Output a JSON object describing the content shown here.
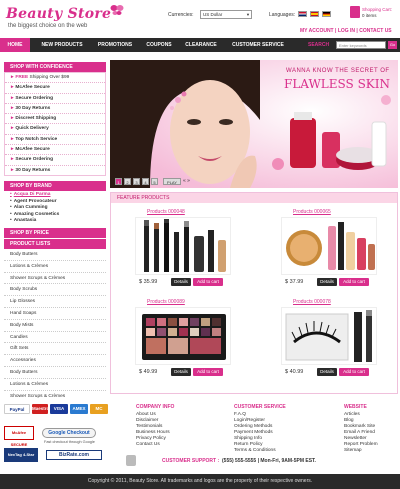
{
  "header": {
    "logo": "Beauty Store",
    "tagline": "the biggest choice on the web",
    "currencies_label": "Currencies:",
    "currency_value": "US Dollar",
    "languages_label": "Languages:",
    "cart_title": "Shopping Cart:",
    "cart_items": "0 items",
    "account_links": [
      "MY ACCOUNT",
      "LOG IN",
      "CONTACT US"
    ],
    "account_sep": " | "
  },
  "nav": {
    "items": [
      "HOME",
      "NEW PRODUCTS",
      "PROMOTIONS",
      "COUPONS",
      "CLEARANCE",
      "CUSTOMER SERVICE"
    ],
    "search_label": "SEARCH",
    "search_placeholder": "Enter keywords",
    "search_go": "Go"
  },
  "sidebar": {
    "shop_confidence_title": "SHOP WITH CONFIDENCE",
    "confidence_items": [
      {
        "prefix": "FREE",
        "label": " Shipping Over $99"
      },
      {
        "prefix": "",
        "label": "McAfee Secure"
      },
      {
        "prefix": "",
        "label": "Secure Ordering"
      },
      {
        "prefix": "",
        "label": "30 Day Returns"
      },
      {
        "prefix": "",
        "label": "Discreet Shipping"
      },
      {
        "prefix": "",
        "label": "Quick Delivery"
      },
      {
        "prefix": "",
        "label": "Top Notch Service"
      },
      {
        "prefix": "",
        "label": "McAfee Secure"
      },
      {
        "prefix": "",
        "label": "Secure Ordering"
      },
      {
        "prefix": "",
        "label": "30 Day Returns"
      }
    ],
    "shop_brand_title": "SHOP BY BRAND",
    "brands": [
      "Acqua Di Parma",
      "Agent Provocateur",
      "Alan Cumming",
      "Amazing Cosmetics",
      "Anastasia"
    ],
    "shop_price_title": "SHOP BY PRICE",
    "product_lists_title": "PRODUCT LISTS",
    "product_lists": [
      "Body Butters",
      "Lotions & Crèmes",
      "Shower Scrups & Crèmes",
      "Body Scrubs",
      "Lip Glosses",
      "Hand Soaps",
      "Body Mists",
      "Candles",
      "Gift Sets",
      "Accessories",
      "Body Butters",
      "Lotions & Crèmes",
      "Shower Scrups & Crèmes"
    ]
  },
  "banner": {
    "line1": "WANNA KNOW THE SECRET OF",
    "line2": "FLAWLESS SKIN",
    "pages": [
      "1",
      "2",
      "3",
      "4",
      "5"
    ],
    "play": "PLAY",
    "nav": "« »"
  },
  "featured": {
    "title": "FEATURE PRODUCTS",
    "products": [
      {
        "name": "Products 000048",
        "price": "$ 35.99"
      },
      {
        "name": "Products 000065",
        "price": "$ 37.99"
      },
      {
        "name": "Products 000089",
        "price": "$ 49.99"
      },
      {
        "name": "Products 000078",
        "price": "$ 40.99"
      }
    ],
    "details_label": "Details",
    "cart_label": "Add to cart"
  },
  "footer": {
    "payments": [
      "PayPal",
      "Maestro",
      "VISA",
      "AMEX",
      "MC"
    ],
    "badges": [
      "McAfee SECURE",
      "NexTag 4-Star Seller",
      "Google Checkout",
      "BizRate.com"
    ],
    "checkout_note": "Fast checkout through Google",
    "company_info_title": "COMPANY INFO",
    "company_info": [
      "About Us",
      "Disclaimer",
      "Testimonials",
      "Business Hours",
      "Privacy Policy",
      "Contact Us"
    ],
    "customer_service_title": "CUSTOMER SERVICE",
    "customer_service": [
      "F.A.Q",
      "Login/Register",
      "Ordering Methods",
      "Payment Methods",
      "Shipping Info",
      "Return Policy",
      "Terms & Conditions"
    ],
    "website_title": "WEBSITE",
    "website": [
      "Articles",
      "Blog",
      "Bookmark Site",
      "Email A Friend",
      "Newsletter",
      "Report Problem",
      "Sitemap"
    ],
    "support_label": "CUSTOMER SUPPORT :",
    "support_number": "(555) 555-5555 | Mon-Fri, 9AM-5PM EST.",
    "copyright": "Copyright © 2011, Beauty Store.  All trademarks and logos are the property of their respective owners."
  },
  "colors": {
    "accent": "#d92f8c",
    "dark": "#2a2a2a",
    "pink_light": "#fbd5e6"
  }
}
